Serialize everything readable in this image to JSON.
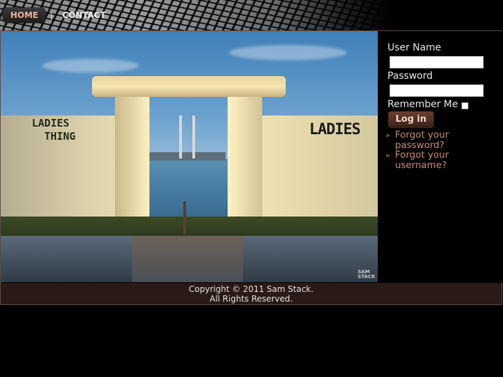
{
  "nav": {
    "home_label": "HOME",
    "separator": "|",
    "contact_label": "CONTACT"
  },
  "photo": {
    "sign_left_line1": "LADIES",
    "sign_left_line2": "THING",
    "sign_right": "LADIES",
    "watermark_line1": "SAM",
    "watermark_line2": "STACK"
  },
  "login": {
    "username_label": "User Name",
    "username_value": "",
    "password_label": "Password",
    "password_value": "",
    "remember_label": "Remember Me",
    "remember_checked": false,
    "login_button": "Log in",
    "forgot_password": "Forgot your password?",
    "forgot_username": "Forgot your username?"
  },
  "footer": {
    "copyright": "Copyright © 2011 Sam Stack.",
    "rights": "All Rights Reserved."
  },
  "colors": {
    "accent": "#c98f76",
    "footer_bg": "#2a1a17",
    "button_bg": "#4e2c20"
  }
}
